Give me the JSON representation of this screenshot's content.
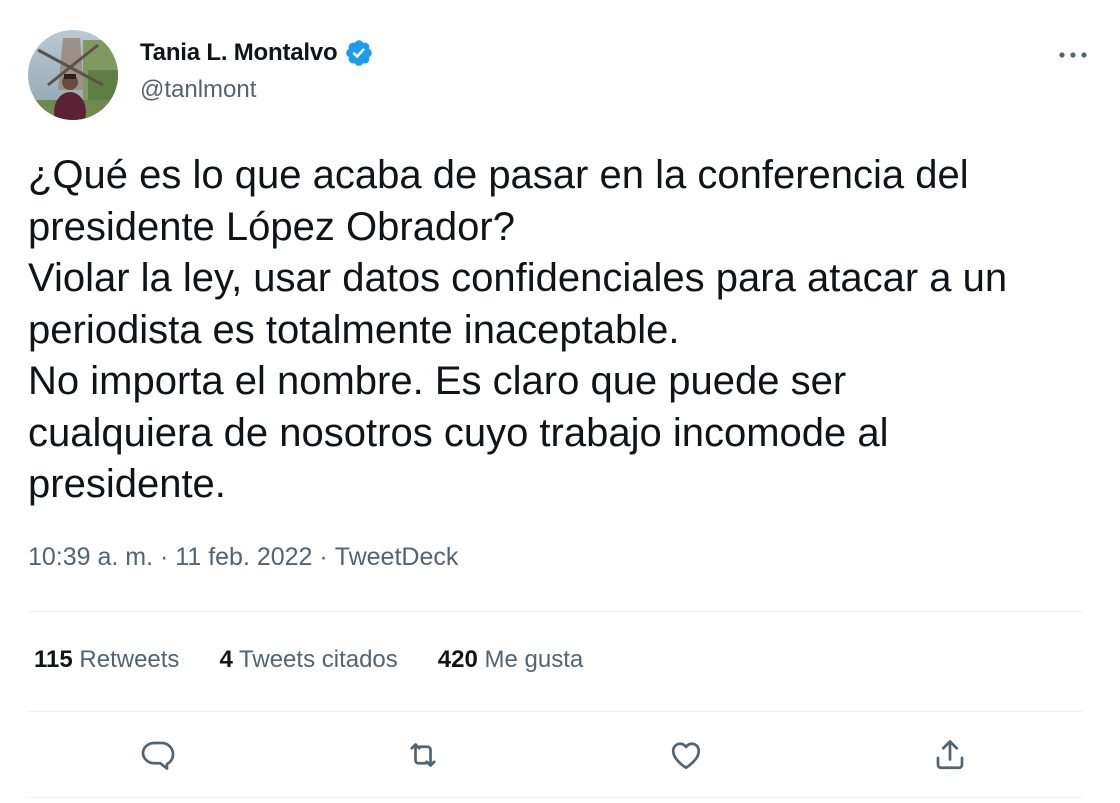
{
  "author": {
    "display_name": "Tania L. Montalvo",
    "handle": "@tanlmont",
    "verified": true,
    "avatar": "avatar-photo"
  },
  "more_icon": "more-dots-icon",
  "tweet": {
    "lines": [
      "¿Qué es lo que acaba de pasar en la conferencia del",
      "presidente López Obrador?",
      "Violar la ley, usar datos confidenciales para atacar a un",
      "periodista es totalmente inaceptable.",
      "No importa el nombre. Es claro que puede ser",
      "cualquiera de nosotros cuyo trabajo incomode al",
      "presidente."
    ]
  },
  "meta": {
    "time": "10:39 a. m.",
    "separator": " · ",
    "date": "11 feb. 2022",
    "source": "TweetDeck"
  },
  "stats": {
    "retweets_count": "115",
    "retweets_label": "Retweets",
    "quotes_count": "4",
    "quotes_label": "Tweets citados",
    "likes_count": "420",
    "likes_label": "Me gusta"
  },
  "actions": [
    "reply-icon",
    "retweet-icon",
    "like-icon",
    "share-icon"
  ],
  "colors": {
    "text": "#0f1419",
    "secondary": "#536471",
    "verified": "#1d9bf0",
    "divider": "#eff3f4"
  }
}
